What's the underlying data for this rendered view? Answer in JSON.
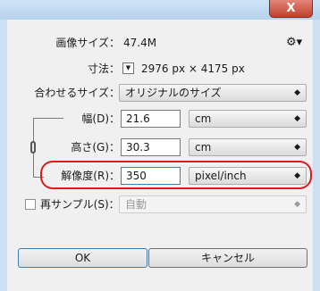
{
  "window": {
    "close_glyph": "X"
  },
  "image_size": {
    "label": "画像サイズ：",
    "value": "47.4M",
    "settings_icon": "gear-icon"
  },
  "dimensions": {
    "label": "寸法：",
    "value": "2976 px × 4175 px",
    "dropdown_icon": "chevron-down-icon"
  },
  "fit_to": {
    "label": "合わせるサイズ：",
    "value": "オリジナルのサイズ"
  },
  "width": {
    "label": "幅(D)：",
    "value": "21.6",
    "unit": "cm"
  },
  "height": {
    "label": "高さ(G)：",
    "value": "30.3",
    "unit": "cm"
  },
  "resolution": {
    "label": "解像度(R)：",
    "value": "350",
    "unit": "pixel/inch",
    "highlight_color": "#e0191f"
  },
  "resample": {
    "label": "再サンプル(S)：",
    "method": "自動",
    "checked": false
  },
  "buttons": {
    "ok": "OK",
    "cancel": "キャンセル"
  }
}
